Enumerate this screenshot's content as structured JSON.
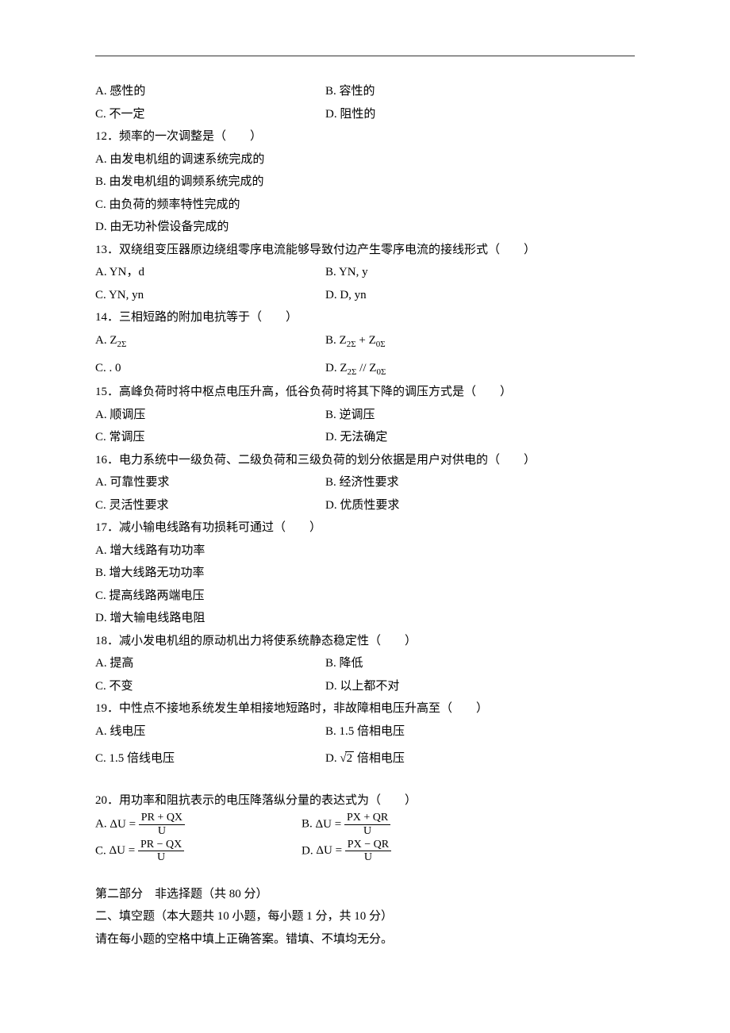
{
  "q11opts": {
    "a": "A. 感性的",
    "b": "B. 容性的",
    "c": "C. 不一定",
    "d": "D. 阻性的"
  },
  "q12": {
    "stem": "12．频率的一次调整是（　　）",
    "a": "A. 由发电机组的调速系统完成的",
    "b": "B. 由发电机组的调频系统完成的",
    "c": "C. 由负荷的频率特性完成的",
    "d": "D. 由无功补偿设备完成的"
  },
  "q13": {
    "stem": "13．双绕组变压器原边绕组零序电流能够导致付边产生零序电流的接线形式（　　）",
    "a": "A. YN，d",
    "b": "B. YN, y",
    "c": "C. YN, yn",
    "d": "D. D, yn"
  },
  "q14": {
    "stem": "14．三相短路的附加电抗等于（　　）",
    "a_label": "A.",
    "a_math_base": "Z",
    "a_math_sub": "2Σ",
    "b_label": "B.",
    "b_math_l_base": "Z",
    "b_math_l_sub": "2Σ",
    "b_math_plus": " + ",
    "b_math_r_base": "Z",
    "b_math_r_sub": "0Σ",
    "c": "C. . 0",
    "d_label": "D.",
    "d_math_l_base": "Z",
    "d_math_l_sub": "2Σ",
    "d_math_par": " // ",
    "d_math_r_base": "Z",
    "d_math_r_sub": "0Σ"
  },
  "q15": {
    "stem": "15．高峰负荷时将中枢点电压升高，低谷负荷时将其下降的调压方式是（　　）",
    "a": "A. 顺调压",
    "b": "B. 逆调压",
    "c": "C. 常调压",
    "d": "D. 无法确定"
  },
  "q16": {
    "stem": "16．电力系统中一级负荷、二级负荷和三级负荷的划分依据是用户对供电的（　　）",
    "a": "A. 可靠性要求",
    "b": "B. 经济性要求",
    "c": "C. 灵活性要求",
    "d": "D. 优质性要求"
  },
  "q17": {
    "stem": "17．减小输电线路有功损耗可通过（　　）",
    "a": "A. 增大线路有功功率",
    "b": "B. 增大线路无功功率",
    "c": "C. 提高线路两端电压",
    "d": "D. 增大输电线路电阻"
  },
  "q18": {
    "stem": "18．减小发电机组的原动机出力将使系统静态稳定性（　　）",
    "a": "A. 提高",
    "b": "B. 降低",
    "c": "C. 不变",
    "d": "D. 以上都不对"
  },
  "q19": {
    "stem": "19．中性点不接地系统发生单相接地短路时，非故障相电压升高至（　　）",
    "a": "A. 线电压",
    "b": "B. 1.5 倍相电压",
    "c": "C. 1.5 倍线电压",
    "d_label": "D. ",
    "d_sqrt_sym": "√",
    "d_sqrt_val": "2",
    "d_tail": " 倍相电压"
  },
  "q20": {
    "stem": "20．用功率和阻抗表示的电压降落纵分量的表达式为（　　）",
    "a_label": "A.",
    "b_label": "B.",
    "c_label": "C.",
    "d_label": "D.",
    "du": "ΔU = ",
    "num_a": "PR + QX",
    "num_b": "PX + QR",
    "num_c": "PR − QX",
    "num_d": "PX − QR",
    "den": "U"
  },
  "part2": {
    "header": "第二部分　非选择题（共 80 分）",
    "fill_header": "二、填空题（本大题共 10 小题，每小题 1 分，共 10 分）",
    "fill_note": "请在每小题的空格中填上正确答案。错填、不填均无分。"
  }
}
